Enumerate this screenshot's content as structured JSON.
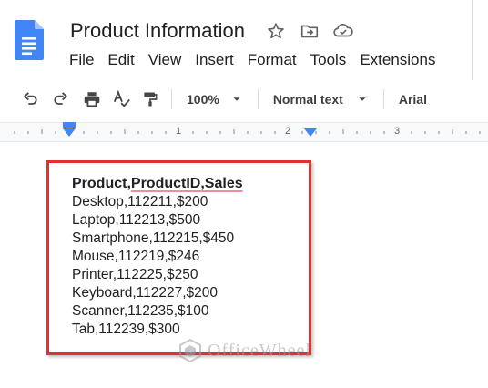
{
  "header": {
    "title": "Product Information",
    "menu": [
      "File",
      "Edit",
      "View",
      "Insert",
      "Format",
      "Tools",
      "Extensions"
    ]
  },
  "toolbar": {
    "zoom": "100%",
    "style": "Normal text",
    "font": "Arial"
  },
  "ruler": {
    "marks": [
      "1",
      "2",
      "3"
    ]
  },
  "document": {
    "header_parts": [
      "Product,",
      "ProductID",
      ",",
      "Sales"
    ],
    "lines": [
      "Desktop,112211,$200",
      "Laptop,112213,$500",
      "Smartphone,112215,$450",
      "Mouse,112219,$246",
      "Printer,112225,$250",
      "Keyboard,112227,$200",
      "Scanner,112235,$100",
      "Tab,112239,$300"
    ]
  },
  "watermark": {
    "text": "OfficeWheel"
  },
  "colors": {
    "docs_blue": "#4285f4",
    "highlight_red": "#e0312e",
    "spell_pink": "#f28b9e"
  },
  "icons": {
    "title": [
      "star-icon",
      "move-to-folder-icon",
      "cloud-status-icon"
    ],
    "toolbar": [
      "undo-icon",
      "redo-icon",
      "print-icon",
      "spellcheck-icon",
      "paint-format-icon"
    ]
  }
}
